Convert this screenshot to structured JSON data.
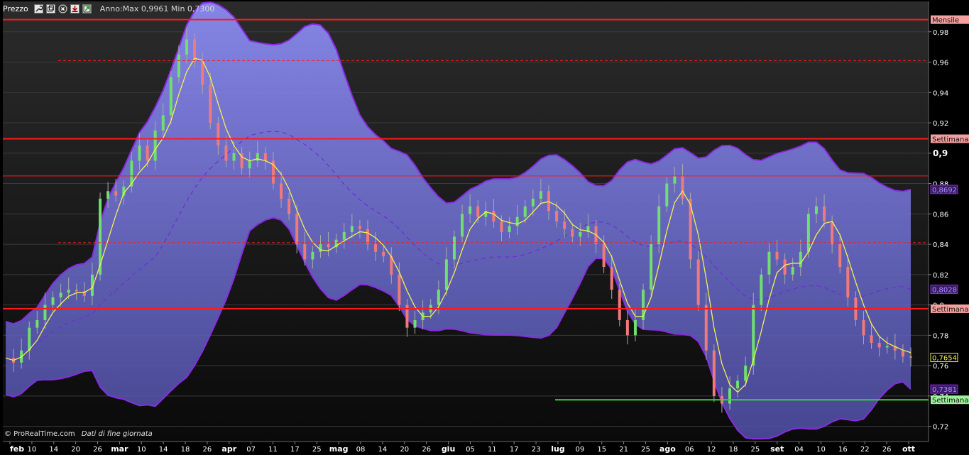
{
  "toolbar": {
    "title": "Prezzo",
    "stats": "Anno:Max 0,9961 Min 0,7300",
    "icons": [
      "wrench-icon",
      "window-icon",
      "close-icon",
      "download-icon",
      "maximize-icon"
    ]
  },
  "footer": {
    "brand": "© ProRealTime.com",
    "note": "Dati di fine giornata"
  },
  "colors": {
    "background_top": "#2b2b2b",
    "background_bottom": "#0a0a0a",
    "band_fill": "#8a8af0",
    "band_edge": "#8a2be2",
    "candle_up": "#6fe06f",
    "candle_down": "#f07a7a",
    "sma_line": "#f5f050",
    "mid_line": "#6a2fd0",
    "resistance": "#ff1a1a",
    "support": "#3fcf3f",
    "axis_text": "#ffffff"
  },
  "chart_data": {
    "type": "candlestick",
    "title": "Prezzo",
    "ylim": [
      0.71,
      1.0
    ],
    "y_ticks": [
      "0,98",
      "0,96",
      "0,94",
      "0,92",
      "0,9",
      "0,88",
      "0,86",
      "0,84",
      "0,82",
      "0,8",
      "0,78",
      "0,76",
      "0,74",
      "0,72"
    ],
    "y_tick_values": [
      0.98,
      0.96,
      0.94,
      0.92,
      0.9,
      0.88,
      0.86,
      0.84,
      0.82,
      0.8,
      0.78,
      0.76,
      0.74,
      0.72
    ],
    "x_tick_labels": [
      "feb",
      "10",
      "14",
      "20",
      "26",
      "mar",
      "10",
      "14",
      "18",
      "26",
      "apr",
      "07",
      "11",
      "17",
      "25",
      "mag",
      "08",
      "14",
      "20",
      "26",
      "giu",
      "05",
      "11",
      "17",
      "23",
      "lug",
      "09",
      "15",
      "21",
      "25",
      "ago",
      "06",
      "12",
      "18",
      "25",
      "set",
      "04",
      "10",
      "16",
      "22",
      "26",
      "ott"
    ],
    "x_tick_bold": [
      "feb",
      "mar",
      "apr",
      "mag",
      "giu",
      "lug",
      "ago",
      "set",
      "ott"
    ],
    "close_series": [
      0.765,
      0.762,
      0.77,
      0.785,
      0.79,
      0.8,
      0.805,
      0.808,
      0.81,
      0.809,
      0.806,
      0.82,
      0.87,
      0.875,
      0.872,
      0.878,
      0.895,
      0.905,
      0.895,
      0.915,
      0.925,
      0.95,
      0.965,
      0.975,
      0.96,
      0.945,
      0.92,
      0.905,
      0.895,
      0.9,
      0.89,
      0.895,
      0.9,
      0.895,
      0.88,
      0.87,
      0.86,
      0.84,
      0.83,
      0.835,
      0.84,
      0.838,
      0.843,
      0.848,
      0.852,
      0.85,
      0.84,
      0.835,
      0.832,
      0.82,
      0.8,
      0.785,
      0.79,
      0.795,
      0.8,
      0.81,
      0.83,
      0.845,
      0.86,
      0.865,
      0.858,
      0.862,
      0.855,
      0.848,
      0.852,
      0.858,
      0.865,
      0.87,
      0.875,
      0.862,
      0.855,
      0.85,
      0.845,
      0.848,
      0.852,
      0.84,
      0.825,
      0.81,
      0.79,
      0.78,
      0.79,
      0.81,
      0.84,
      0.865,
      0.88,
      0.885,
      0.87,
      0.83,
      0.8,
      0.77,
      0.74,
      0.735,
      0.745,
      0.75,
      0.76,
      0.8,
      0.82,
      0.835,
      0.83,
      0.82,
      0.825,
      0.835,
      0.86,
      0.865,
      0.855,
      0.84,
      0.825,
      0.805,
      0.79,
      0.78,
      0.775,
      0.772,
      0.773,
      0.77,
      0.766,
      0.7654
    ],
    "last_price": "0,7654",
    "band_labels": [
      "0,8692",
      "0,8028",
      "0,7381"
    ],
    "levels": [
      {
        "name": "Mensile",
        "value": 0.988,
        "style": "solid",
        "color": "#ff1a1a"
      },
      {
        "name": "Settimana",
        "value": 0.9095,
        "style": "solid",
        "color": "#ff1a1a"
      },
      {
        "name": "Settimana",
        "value": 0.7975,
        "style": "solid",
        "color": "#ff1a1a"
      },
      {
        "name": "Settimana",
        "value": 0.7375,
        "style": "solid",
        "color": "#3fcf3f"
      },
      {
        "name": "",
        "value": 0.885,
        "style": "solid",
        "color": "#ff1a1a"
      },
      {
        "name": "",
        "value": 0.961,
        "style": "dashed",
        "color": "#ff1a1a"
      },
      {
        "name": "",
        "value": 0.841,
        "style": "dashed",
        "color": "#ff1a1a"
      }
    ],
    "grid": true
  }
}
